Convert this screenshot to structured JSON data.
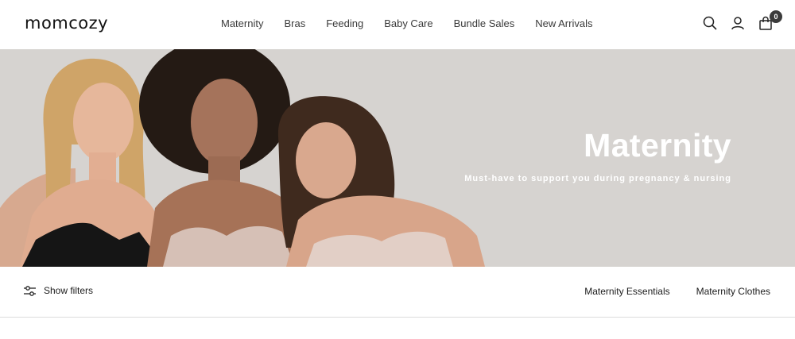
{
  "header": {
    "logo": "momcozy",
    "nav": [
      "Maternity",
      "Bras",
      "Feeding",
      "Baby Care",
      "Bundle Sales",
      "New Arrivals"
    ],
    "icons": [
      "search-icon",
      "account-icon",
      "cart-icon"
    ],
    "cart_count": "0"
  },
  "hero": {
    "title": "Maternity",
    "subtitle": "Must-have to support you during pregnancy & nursing",
    "background": "#d6d3d0"
  },
  "filters": {
    "show_filters_label": "Show filters",
    "categories": [
      "Maternity Essentials",
      "Maternity Clothes"
    ]
  }
}
